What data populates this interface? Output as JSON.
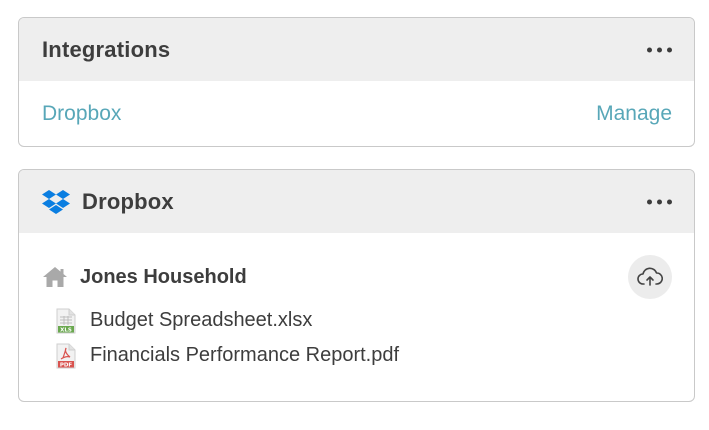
{
  "integrations": {
    "title": "Integrations",
    "more_icon": "more-horizontal-icon",
    "item_label": "Dropbox",
    "manage_label": "Manage",
    "link_color": "#58a7b8"
  },
  "dropbox": {
    "title": "Dropbox",
    "logo_icon": "dropbox-logo-icon",
    "brand_color": "#0a7ee1",
    "more_icon": "more-horizontal-icon",
    "folder": {
      "icon": "home-icon",
      "name": "Jones Household"
    },
    "upload_icon": "cloud-upload-icon",
    "files": [
      {
        "name": "Budget Spreadsheet.xlsx",
        "icon": "xls-file-icon",
        "badge": "XLS",
        "badge_color": "#6aa84f"
      },
      {
        "name": "Financials Performance Report.pdf",
        "icon": "pdf-file-icon",
        "badge": "PDF",
        "badge_color": "#d9534f"
      }
    ]
  }
}
